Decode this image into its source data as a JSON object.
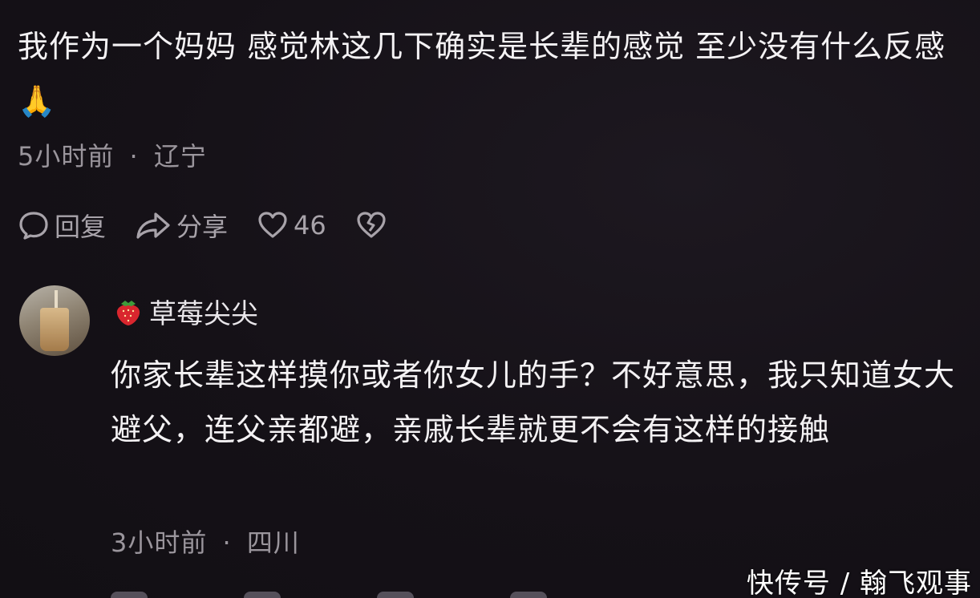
{
  "comment": {
    "text": "我作为一个妈妈 感觉林这几下确实是长辈的感觉 至少没有什么反感 🙏",
    "time": "5小时前",
    "separator": "·",
    "location": "辽宁",
    "actions": {
      "reply_label": "回复",
      "share_label": "分享",
      "like_count": "46"
    }
  },
  "reply": {
    "username": "草莓尖尖",
    "text": "你家长辈这样摸你或者你女儿的手？不好意思，我只知道女大避父，连父亲都避，亲戚长辈就更不会有这样的接触",
    "time": "3小时前",
    "separator": "·",
    "location": "四川"
  },
  "watermark": "快传号 / 翰飞观事",
  "colors": {
    "background": "#151117",
    "text": "#f4f2f4",
    "muted": "#9a959c"
  },
  "icons": [
    "comment-bubble-icon",
    "share-arrow-icon",
    "heart-icon",
    "broken-heart-icon",
    "strawberry-icon"
  ]
}
